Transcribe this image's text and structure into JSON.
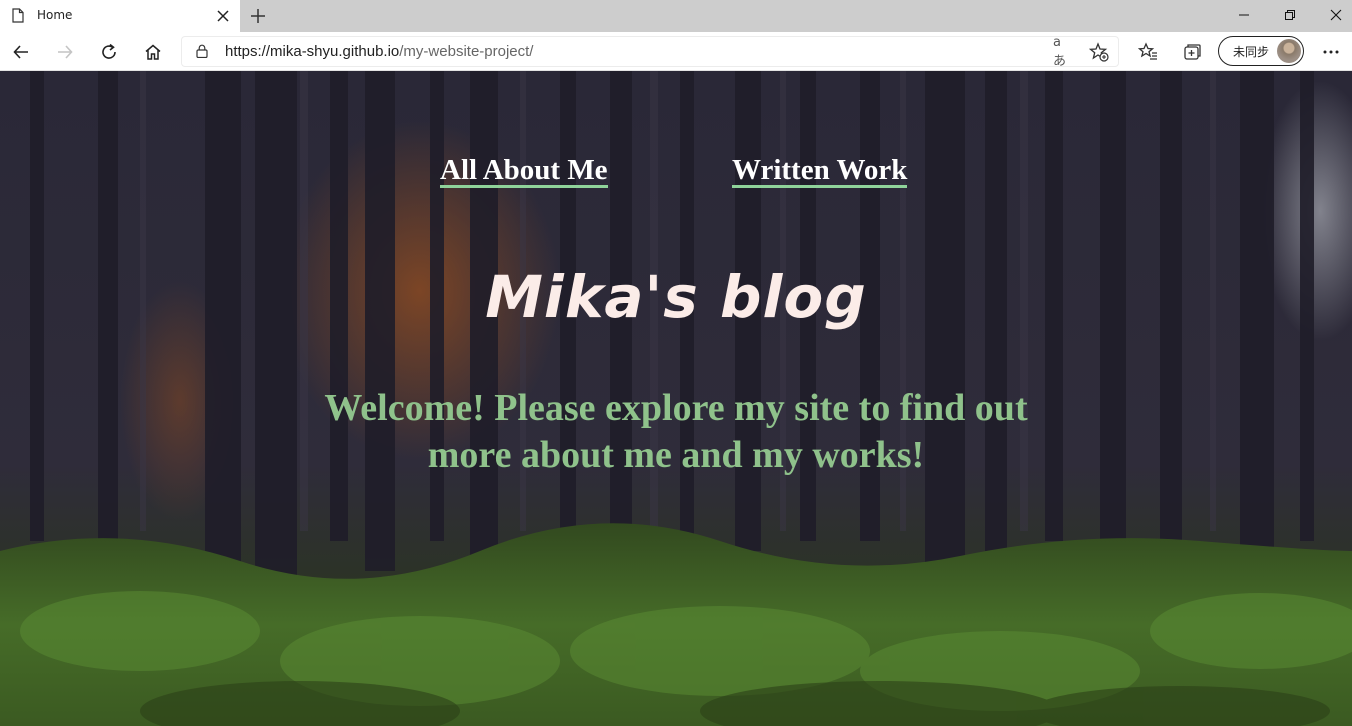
{
  "browser": {
    "tab_title": "Home",
    "url_host": "https://mika-shyu.github.io",
    "url_path": "/my-website-project/",
    "read_aloud_label": "aあ",
    "profile_label": "未同步"
  },
  "page": {
    "nav": {
      "about_label": "All About Me",
      "work_label": "Written Work"
    },
    "title": "Mika's blog",
    "welcome": "Welcome! Please explore my site to find out more about me and my works!"
  },
  "colors": {
    "nav_underline": "#8fd39a",
    "title": "#fbece8",
    "welcome": "#8fc28b"
  }
}
